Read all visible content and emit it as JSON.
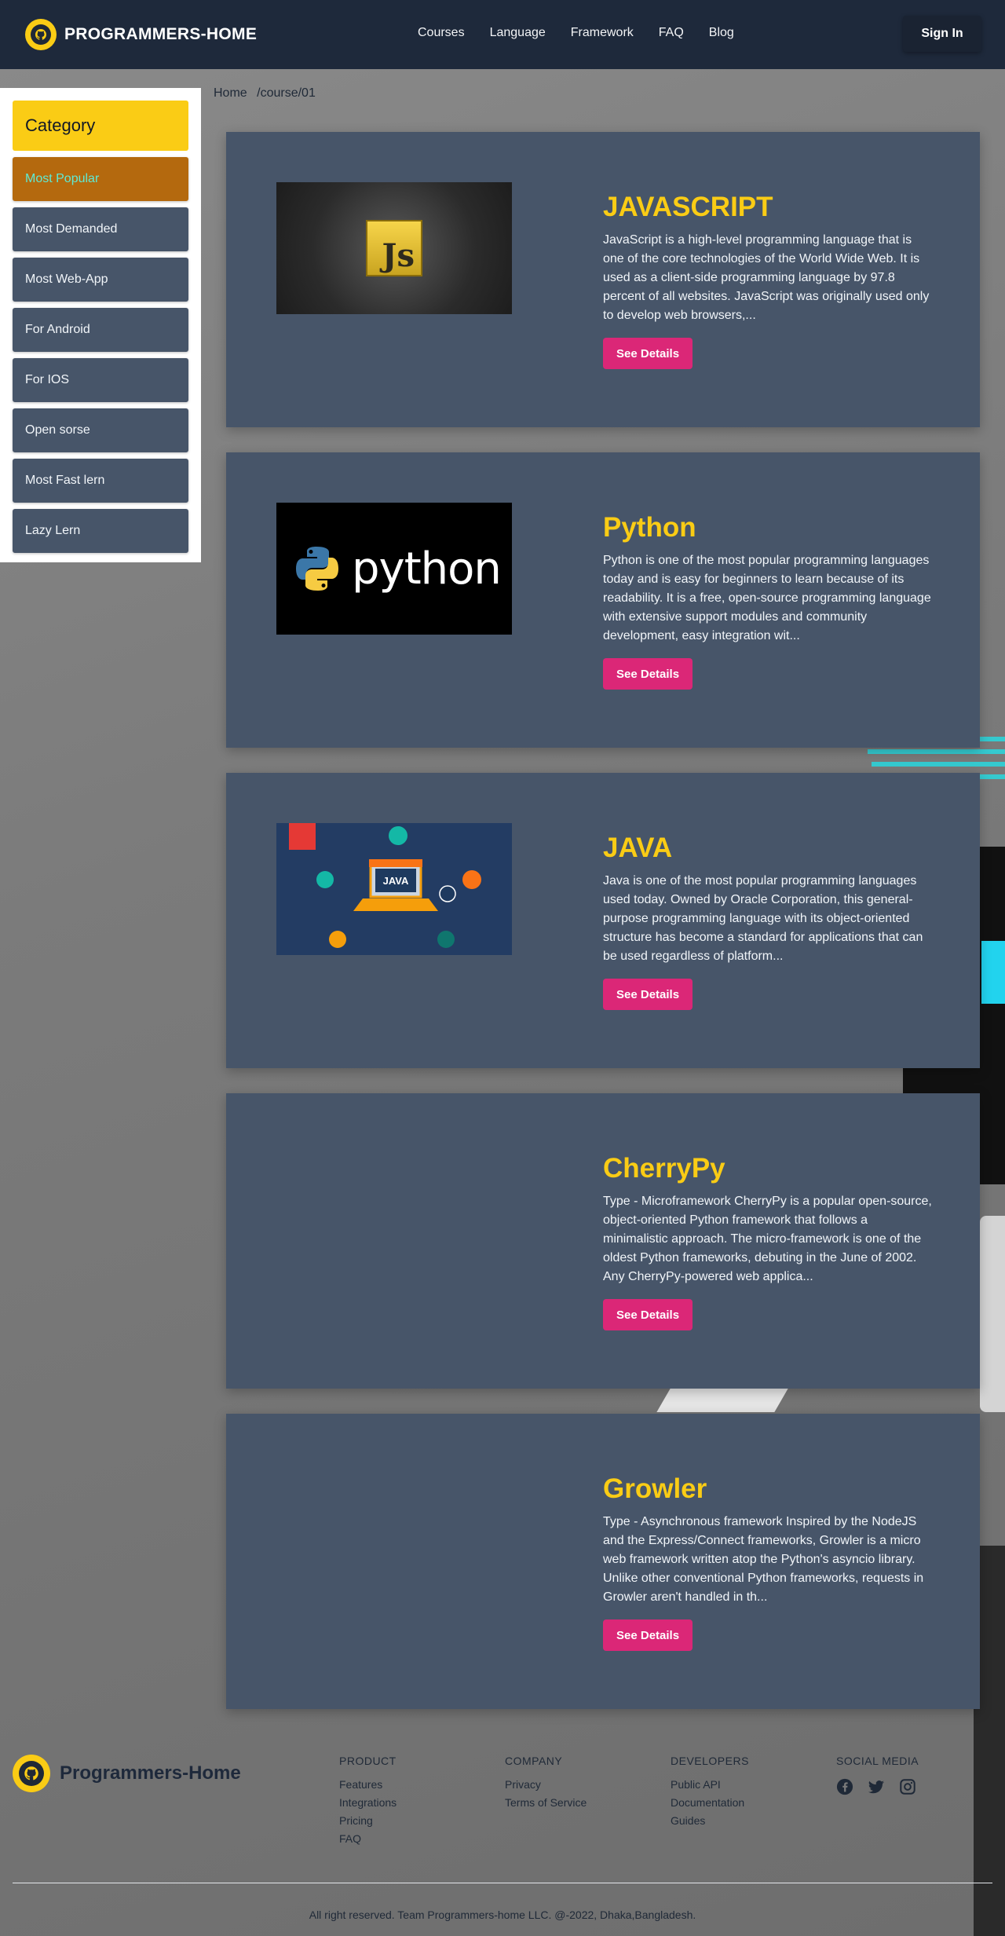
{
  "header": {
    "brand": "PROGRAMMERS-HOME",
    "nav": [
      "Courses",
      "Language",
      "Framework",
      "FAQ",
      "Blog"
    ],
    "signin_label": "Sign In"
  },
  "sidebar": {
    "title": "Category",
    "items": [
      {
        "label": "Most Popular",
        "active": true
      },
      {
        "label": "Most Demanded"
      },
      {
        "label": "Most Web-App"
      },
      {
        "label": "For Android"
      },
      {
        "label": "For IOS"
      },
      {
        "label": "Open sorse"
      },
      {
        "label": "Most Fast lern"
      },
      {
        "label": "Lazy Lern"
      }
    ]
  },
  "breadcrumb": {
    "home": "Home",
    "path": "/course/01"
  },
  "courses": [
    {
      "title": "JAVASCRIPT",
      "description": "JavaScript is a high-level programming language that is one of the core technologies of the World Wide Web. It is used as a client-side programming language by 97.8 percent of all websites. JavaScript was originally used only to develop web browsers,...",
      "button": "See Details",
      "thumb_text": "Js"
    },
    {
      "title": "Python",
      "description": "Python is one of the most popular programming languages today and is easy for beginners to learn because of its readability. It is a free, open-source programming language with extensive support modules and community development, easy integration wit...",
      "button": "See Details",
      "thumb_text": "python"
    },
    {
      "title": "JAVA",
      "description": "Java is one of the most popular programming languages used today. Owned by Oracle Corporation, this general-purpose programming language with its object-oriented structure has become a standard for applications that can be used regardless of platform...",
      "button": "See Details",
      "thumb_text": "JAVA"
    },
    {
      "title": "CherryPy",
      "description": "Type - Microframework CherryPy is a popular open-source, object-oriented Python framework that follows a minimalistic approach. The micro-framework is one of the oldest Python frameworks, debuting in the June of 2002. Any CherryPy-powered web applica...",
      "button": "See Details"
    },
    {
      "title": "Growler",
      "description": "Type - Asynchronous framework Inspired by the NodeJS and the Express/Connect frameworks, Growler is a micro web framework written atop the Python's asyncio library. Unlike other conventional Python frameworks, requests in Growler aren't handled in th...",
      "button": "See Details"
    }
  ],
  "footer": {
    "brand": "Programmers-Home",
    "columns": [
      {
        "heading": "PRODUCT",
        "links": [
          "Features",
          "Integrations",
          "Pricing",
          "FAQ"
        ]
      },
      {
        "heading": "COMPANY",
        "links": [
          "Privacy",
          "Terms of Service"
        ]
      },
      {
        "heading": "DEVELOPERS",
        "links": [
          "Public API",
          "Documentation",
          "Guides"
        ]
      }
    ],
    "social_heading": "SOCIAL MEDIA",
    "social_icons": [
      "facebook-icon",
      "twitter-icon",
      "instagram-icon"
    ],
    "copyright": "All right reserved. Team Programmers-home LLC. @-2022, Dhaka,Bangladesh."
  },
  "colors": {
    "header_bg": "#1e293b",
    "accent_yellow": "#facc15",
    "card_bg": "#475569",
    "button_pink": "#db2777",
    "active_category": "#b4690e"
  }
}
